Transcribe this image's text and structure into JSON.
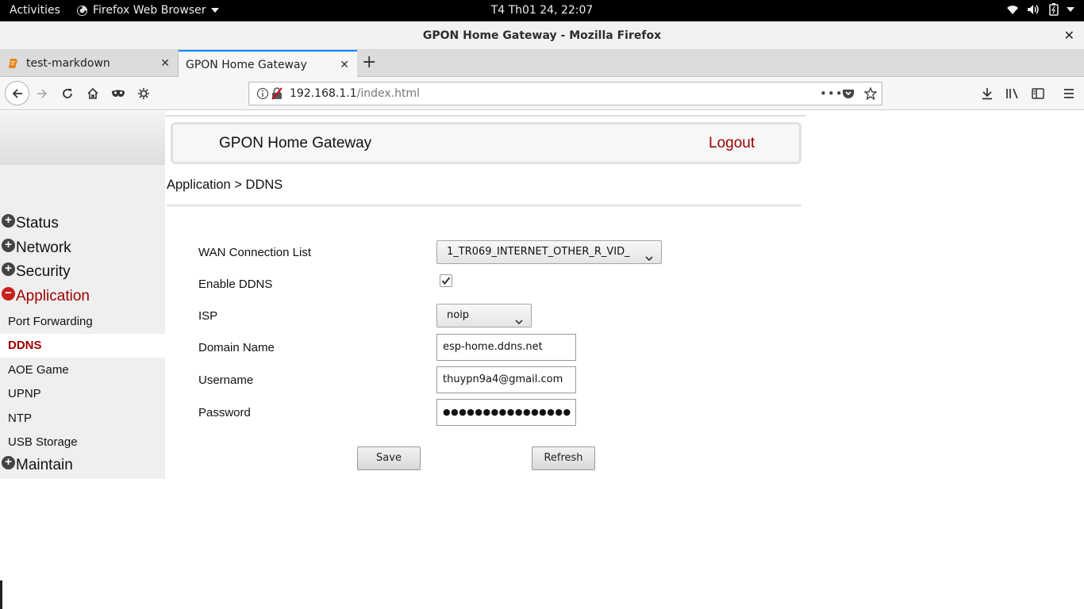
{
  "desktop": {
    "activities_label": "Activities",
    "app_menu_label": "Firefox Web Browser",
    "clock": "T4 Th01 24, 22:07"
  },
  "window": {
    "title": "GPON Home Gateway - Mozilla Firefox"
  },
  "tabs": [
    {
      "label": "test-markdown"
    },
    {
      "label": "GPON Home Gateway"
    }
  ],
  "address_bar": {
    "host": "192.168.1.1",
    "path": "/index.html"
  },
  "page": {
    "header_title": "GPON Home Gateway",
    "logout_label": "Logout",
    "breadcrumb": "Application > DDNS",
    "menu": {
      "status": "Status",
      "network": "Network",
      "security": "Security",
      "application": "Application",
      "port_forwarding": "Port Forwarding",
      "ddns": "DDNS",
      "aoe_game": "AOE Game",
      "upnp": "UPNP",
      "ntp": "NTP",
      "usb_storage": "USB Storage",
      "maintain": "Maintain"
    },
    "form": {
      "wan_label": "WAN Connection List",
      "wan_value": "1_TR069_INTERNET_OTHER_R_VID_",
      "enable_label": "Enable DDNS",
      "enable_checked": true,
      "isp_label": "ISP",
      "isp_value": "noip",
      "domain_label": "Domain Name",
      "domain_value": "esp-home.ddns.net",
      "username_label": "Username",
      "username_value": "thuypn9a4@gmail.com",
      "password_label": "Password",
      "password_mask": "●●●●●●●●●●●●●●●●",
      "save_label": "Save",
      "refresh_label": "Refresh"
    }
  }
}
